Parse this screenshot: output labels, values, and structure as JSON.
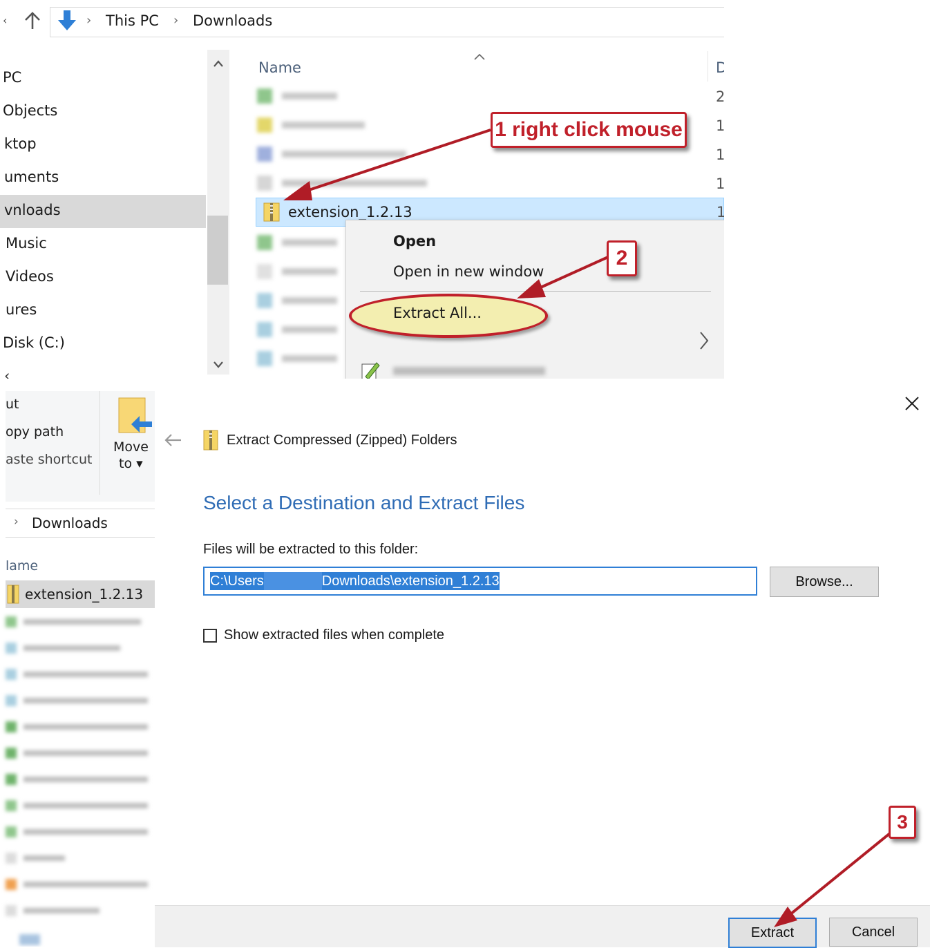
{
  "explorer": {
    "breadcrumb": [
      "This PC",
      "Downloads"
    ],
    "sidebar": {
      "items": [
        {
          "label": "PC",
          "selected": false
        },
        {
          "label": "Objects",
          "selected": false
        },
        {
          "label": "ktop",
          "selected": false
        },
        {
          "label": "uments",
          "selected": false
        },
        {
          "label": "vnloads",
          "selected": true
        },
        {
          "label": "Music",
          "selected": false
        },
        {
          "label": "Videos",
          "selected": false
        },
        {
          "label": "ures",
          "selected": false
        },
        {
          "label": "Disk (C:)",
          "selected": false
        }
      ]
    },
    "columns": {
      "name": "Name",
      "date_partial": "D"
    },
    "selected_file": {
      "name": "extension_1.2.13"
    },
    "date_digits": [
      "2",
      "1",
      "1",
      "1",
      "1"
    ]
  },
  "context_menu": {
    "items": [
      "Open",
      "Open in new window",
      "Extract All..."
    ]
  },
  "annotations": {
    "step1": "1 right click mouse",
    "step2": "2",
    "step3": "3"
  },
  "second_explorer": {
    "ribbon": {
      "cut": "ut",
      "copy_path": "opy path",
      "paste_shortcut": "aste shortcut",
      "move_to_line1": "Move",
      "move_to_line2": "to"
    },
    "breadcrumb": "Downloads",
    "column_name": "lame",
    "selected_file": "extension_1.2.13"
  },
  "wizard": {
    "title": "Extract Compressed (Zipped) Folders",
    "heading": "Select a Destination and Extract Files",
    "folder_label": "Files will be extracted to this folder:",
    "path_start": "C:\\Users",
    "path_end": "Downloads\\extension_1.2.13",
    "browse_label": "Browse...",
    "checkbox_label": "Show extracted files when complete",
    "checkbox_checked": false,
    "extract_label": "Extract",
    "cancel_label": "Cancel"
  },
  "colors": {
    "accent": "#2f6cb5",
    "selection": "#cce8ff",
    "callout_red": "#c0202a",
    "highlight_yellow": "#f3eeb0"
  }
}
